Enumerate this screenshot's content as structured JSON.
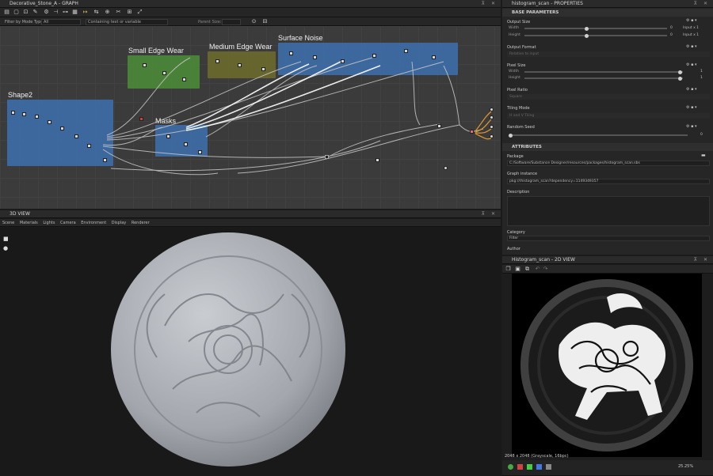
{
  "graph": {
    "title": "Decorative_Stone_A - GRAPH",
    "filter_label": "Filter by Mode Type",
    "filter_value": "All",
    "search_placeholder": "Containing text or variable",
    "parent_size_label": "Parent Size:",
    "frames": [
      {
        "label": "Shape2",
        "color": "#3d6ea8"
      },
      {
        "label": "Small Edge Wear",
        "color": "#4c8a3a"
      },
      {
        "label": "Medium Edge Wear",
        "color": "#6b6a2e"
      },
      {
        "label": "Surface Noise",
        "color": "#3d6ea8"
      },
      {
        "label": "Masks",
        "color": "#3d6ea8"
      }
    ]
  },
  "view3d": {
    "title": "3D VIEW",
    "menu": [
      "Scene",
      "Materials",
      "Lights",
      "Camera",
      "Environment",
      "Display",
      "Renderer"
    ]
  },
  "properties": {
    "title": "histogram_scan - PROPERTIES",
    "base_header": "BASE PARAMETERS",
    "output_size": {
      "label": "Output Size",
      "width_label": "Width",
      "height_label": "Height",
      "width_val": "0",
      "height_val": "0",
      "width_unit": "Input x 1",
      "height_unit": "Input x 1"
    },
    "output_format": {
      "label": "Output Format",
      "value": "Relative to input"
    },
    "pixel_size": {
      "label": "Pixel Size",
      "width_label": "Width",
      "height_label": "Height",
      "width_val": "1",
      "height_val": "1"
    },
    "pixel_ratio": {
      "label": "Pixel Ratio",
      "value": "Square"
    },
    "tiling_mode": {
      "label": "Tiling Mode",
      "value": "H and V Tiling"
    },
    "random_seed": {
      "label": "Random Seed",
      "value": "0"
    },
    "attributes_header": "ATTRIBUTES",
    "package_label": "Package",
    "package_value": "C:/Software/Substance Designer/resources/packages/histogram_scan.sbs",
    "graph_instance_label": "Graph instance",
    "graph_instance_value": "pkg:///histogram_scan?dependency=1149349357",
    "description_label": "Description",
    "category_label": "Category",
    "category_value": "Filter",
    "author_label": "Author"
  },
  "view2d": {
    "title": "Histogram_scan - 2D VIEW",
    "status": "2048 x 2048 (Grayscale, 16bpc)",
    "zoom": "25.25%"
  }
}
